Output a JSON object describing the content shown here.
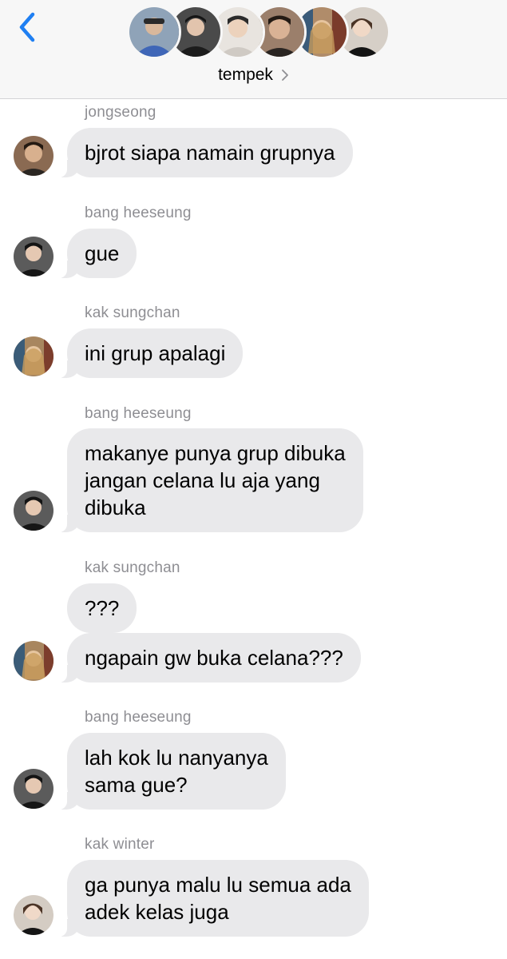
{
  "header": {
    "group_name": "tempek",
    "back_icon": "chevron-left-icon",
    "accent_color": "#1f7ff2"
  },
  "messages": [
    {
      "sender": "jongseong",
      "text": "bjrot siapa namain grupnya",
      "avatar": "avatar-jongseong"
    },
    {
      "sender": "bang heeseung",
      "text": "gue",
      "avatar": "avatar-heeseung"
    },
    {
      "sender": "kak sungchan",
      "text": "ini grup apalagi",
      "avatar": "avatar-sungchan"
    },
    {
      "sender": "bang heeseung",
      "text": "makanye punya grup dibuka\njangan celana lu aja yang\ndibuka",
      "avatar": "avatar-heeseung"
    },
    {
      "sender": "kak sungchan",
      "text": "???",
      "avatar": ""
    },
    {
      "sender": "",
      "text": "ngapain gw buka celana???",
      "avatar": "avatar-sungchan"
    },
    {
      "sender": "bang heeseung",
      "text": "lah kok lu nanyanya\nsama gue?",
      "avatar": "avatar-heeseung"
    },
    {
      "sender": "kak winter",
      "text": "ga punya malu lu semua ada\nadek kelas juga",
      "avatar": "avatar-winter"
    }
  ]
}
